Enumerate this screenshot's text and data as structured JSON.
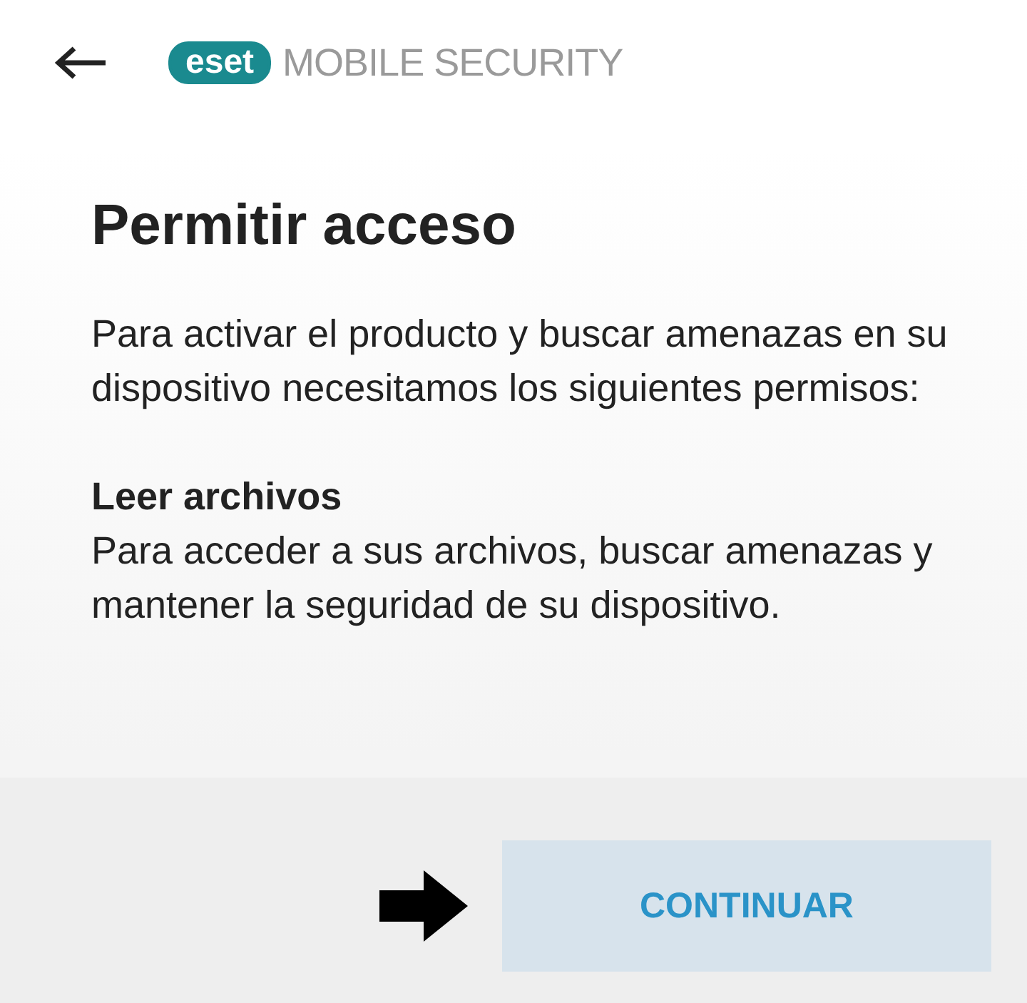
{
  "header": {
    "logo_mark": "eset",
    "logo_text": "MOBILE SECURITY"
  },
  "title": "Permitir acceso",
  "intro": "Para activar el producto y buscar amenazas en su dispositivo necesitamos los siguientes permisos:",
  "permissions": [
    {
      "name": "Leer archivos",
      "description": "Para acceder a sus archivos, buscar amenazas y mantener la seguridad de su dispositivo."
    }
  ],
  "buttons": [
    {
      "label": "CONTINUAR"
    }
  ]
}
